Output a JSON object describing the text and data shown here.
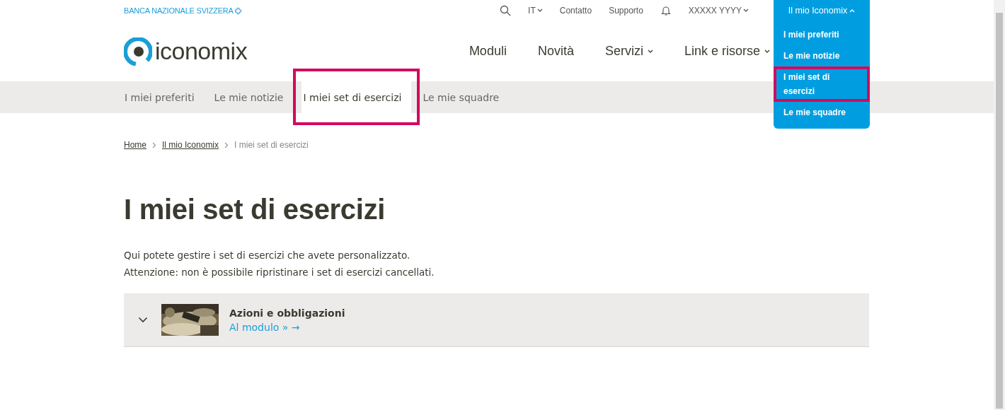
{
  "topbar": {
    "brand": "BANCA NAZIONALE SVIZZERA",
    "language": "IT",
    "links": [
      "Contatto",
      "Supporto"
    ],
    "user": "XXXXX YYYY"
  },
  "account_menu": {
    "label": "Il mio Iconomix",
    "expanded": true,
    "items": [
      {
        "label": "I miei preferiti",
        "highlighted": false
      },
      {
        "label": "Le mie notizie",
        "highlighted": false
      },
      {
        "label": "I miei set di esercizi",
        "highlighted": true
      },
      {
        "label": "Le mie squadre",
        "highlighted": false
      }
    ]
  },
  "logo": {
    "text": "iconomix"
  },
  "main_nav": [
    {
      "label": "Moduli",
      "has_menu": false
    },
    {
      "label": "Novità",
      "has_menu": false
    },
    {
      "label": "Servizi",
      "has_menu": true
    },
    {
      "label": "Link e risorse",
      "has_menu": true
    }
  ],
  "sub_nav": [
    {
      "label": "I miei preferiti",
      "selected": false,
      "highlighted": false
    },
    {
      "label": "Le mie notizie",
      "selected": false,
      "highlighted": false
    },
    {
      "label": "I miei set di esercizi",
      "selected": true,
      "highlighted": true
    },
    {
      "label": "Le mie squadre",
      "selected": false,
      "highlighted": false
    }
  ],
  "breadcrumb": [
    {
      "label": "Home",
      "link": true
    },
    {
      "label": "Il mio Iconomix",
      "link": true
    },
    {
      "label": "I miei set di esercizi",
      "link": false
    }
  ],
  "title": "I miei set di esercizi",
  "intro": [
    "Qui potete gestire i set di esercizi che avete personalizzato.",
    "Attenzione: non è possibile ripristinare i set di esercizi cancellati."
  ],
  "exercise_sets": [
    {
      "title": "Azioni e obbligazioni",
      "link": "Al modulo » →",
      "expanded": false
    }
  ]
}
